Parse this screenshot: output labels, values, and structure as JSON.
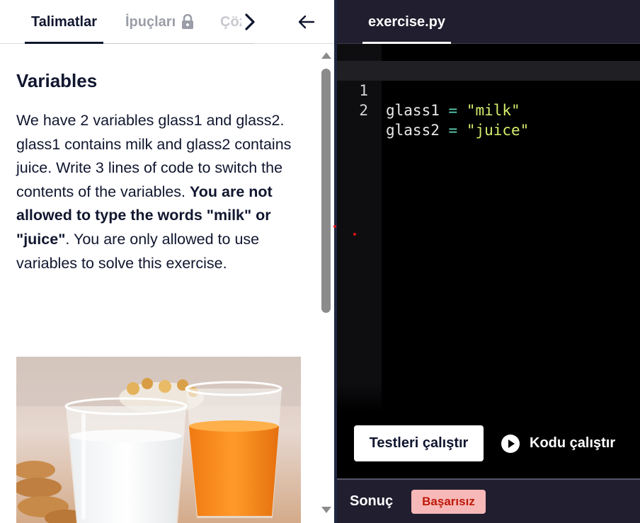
{
  "tabs": {
    "instructions": "Talimatlar",
    "hints": "İpuçları",
    "solution": "Çözüm"
  },
  "lesson": {
    "title": "Variables",
    "paragraph_start": "We have 2 variables glass1 and glass2. glass1 contains milk and glass2 contains juice. Write 3 lines of code to switch the contents of the variables. ",
    "paragraph_bold": "You are not allowed to type the words \"milk\" or \"juice\"",
    "paragraph_end": ". You are only allowed to use variables to solve this exercise.",
    "image_icon": "milk-and-juice-glasses-photo"
  },
  "editor": {
    "filename": "exercise.py",
    "lines": [
      {
        "number": "1",
        "var": "glass1",
        "op": "=",
        "value": "\"milk\""
      },
      {
        "number": "2",
        "var": "glass2",
        "op": "=",
        "value": "\"juice\""
      }
    ]
  },
  "actions": {
    "run_tests": "Testleri çalıştır",
    "run_code": "Kodu çalıştır"
  },
  "result": {
    "label": "Sonuç",
    "status": "Başarısız"
  },
  "icons": {
    "lock": "lock-icon",
    "chevron_right": "chevron-right-icon",
    "collapse": "arrow-left-icon",
    "play": "play-icon"
  },
  "colors": {
    "ink": "#10162f",
    "editor_bg": "#000000",
    "header_bg": "#211e2f",
    "string": "#d4ee6e",
    "operator": "#5bd6b8",
    "fail_bg": "#f7b9b8",
    "fail_text": "#be1809"
  }
}
